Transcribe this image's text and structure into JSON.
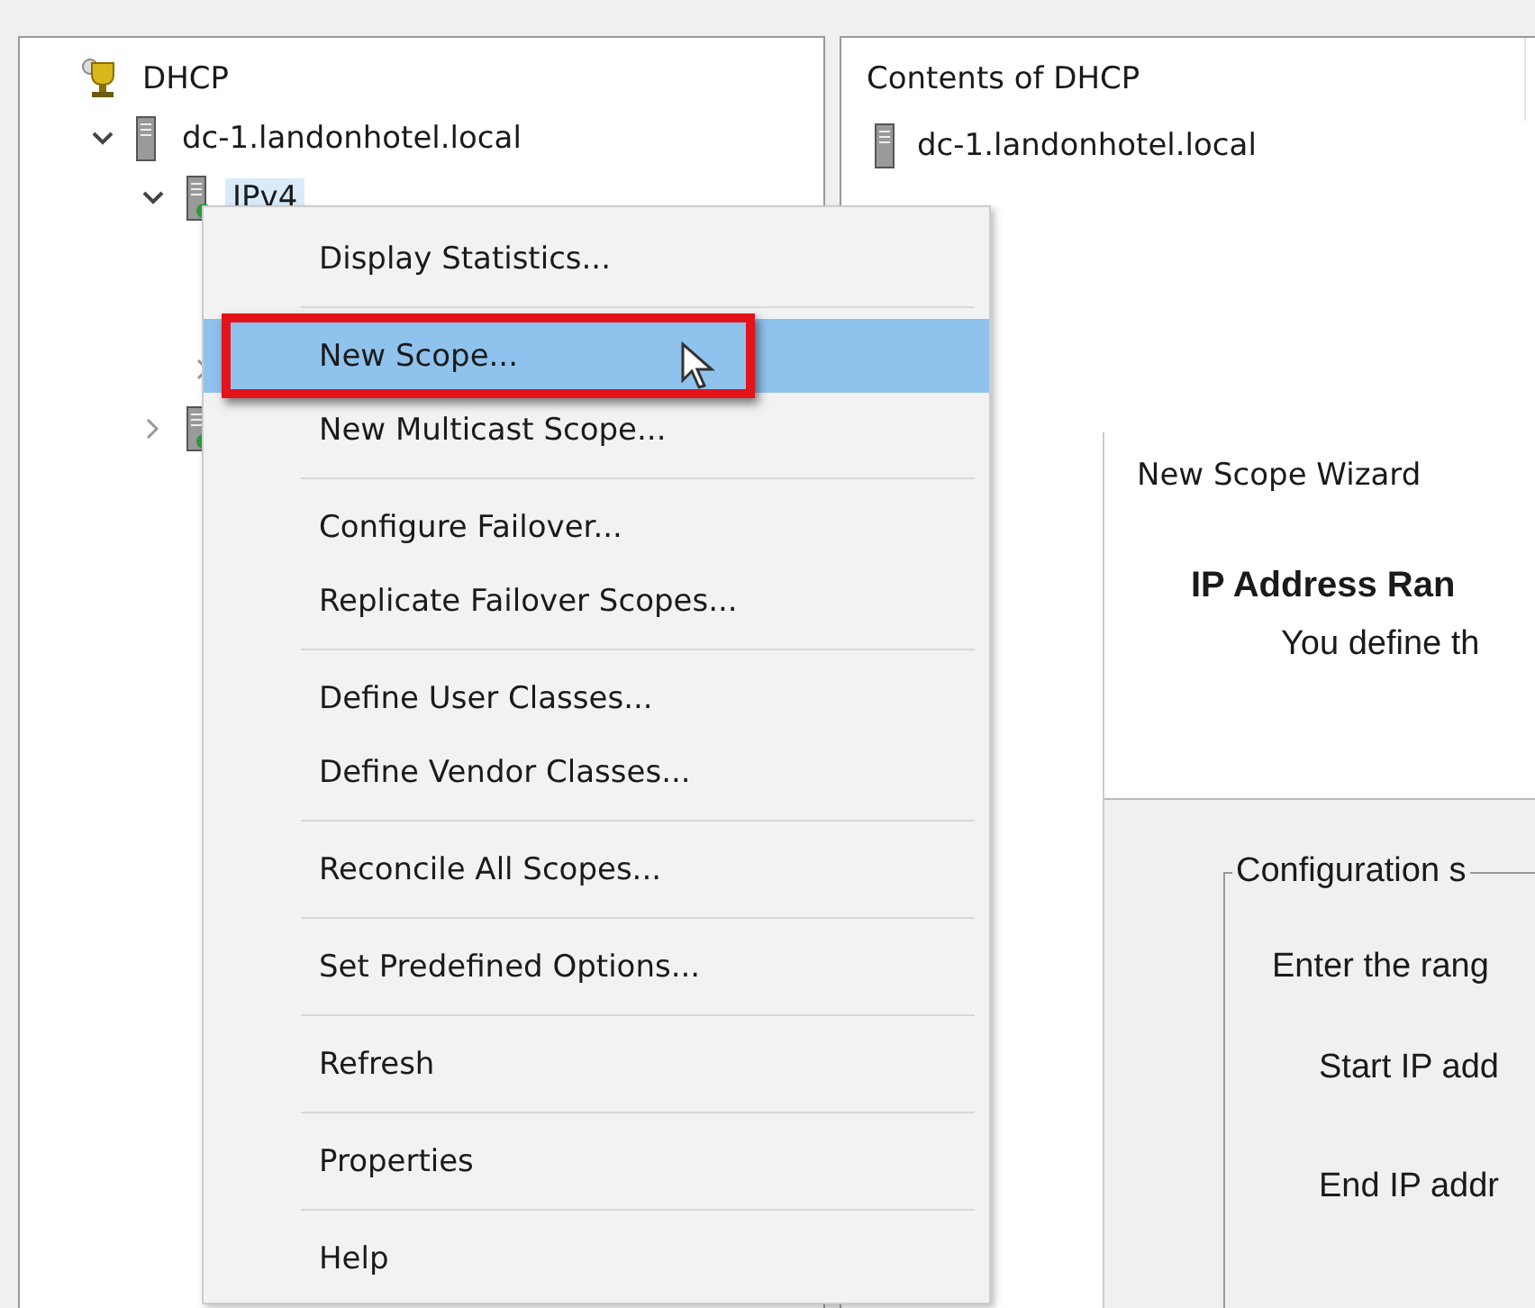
{
  "tree": [
    {
      "label": "DHCP",
      "kind": "root",
      "children": [
        {
          "label": "dc-1.landonhotel.local",
          "kind": "server",
          "expanded": true,
          "children": [
            {
              "label": "IPv4",
              "kind": "protocol",
              "expanded": true,
              "selected": true,
              "children": [
                {
                  "expanded": false
                }
              ]
            },
            {
              "kind": "protocol",
              "expanded": false
            }
          ]
        }
      ]
    }
  ],
  "contents": {
    "title": "Contents of DHCP",
    "items": [
      {
        "label": "dc-1.landonhotel.local"
      }
    ]
  },
  "context_menu": {
    "groups": [
      [
        {
          "label": "Display Statistics...",
          "selected": false,
          "callout": false
        }
      ],
      [
        {
          "label": "New Scope...",
          "selected": true,
          "callout": true
        },
        {
          "label": "New Multicast Scope...",
          "selected": false,
          "callout": false
        }
      ],
      [
        {
          "label": "Configure Failover...",
          "selected": false,
          "callout": false
        },
        {
          "label": "Replicate Failover Scopes...",
          "selected": false,
          "callout": false
        }
      ],
      [
        {
          "label": "Define User Classes...",
          "selected": false,
          "callout": false
        },
        {
          "label": "Define Vendor Classes...",
          "selected": false,
          "callout": false
        }
      ],
      [
        {
          "label": "Reconcile All Scopes...",
          "selected": false,
          "callout": false
        }
      ],
      [
        {
          "label": "Set Predefined Options...",
          "selected": false,
          "callout": false
        }
      ],
      [
        {
          "label": "Refresh",
          "selected": false,
          "callout": false
        }
      ],
      [
        {
          "label": "Properties",
          "selected": false,
          "callout": false
        }
      ],
      [
        {
          "label": "Help",
          "selected": false,
          "callout": false
        }
      ]
    ]
  },
  "wizard": {
    "title": "New Scope Wizard",
    "heading": "IP Address Ran",
    "description": "You define th",
    "group_label": "Configuration s",
    "prompt": "Enter the rang",
    "fields": [
      {
        "label": "Start IP add"
      },
      {
        "label": "End IP addr"
      }
    ]
  }
}
